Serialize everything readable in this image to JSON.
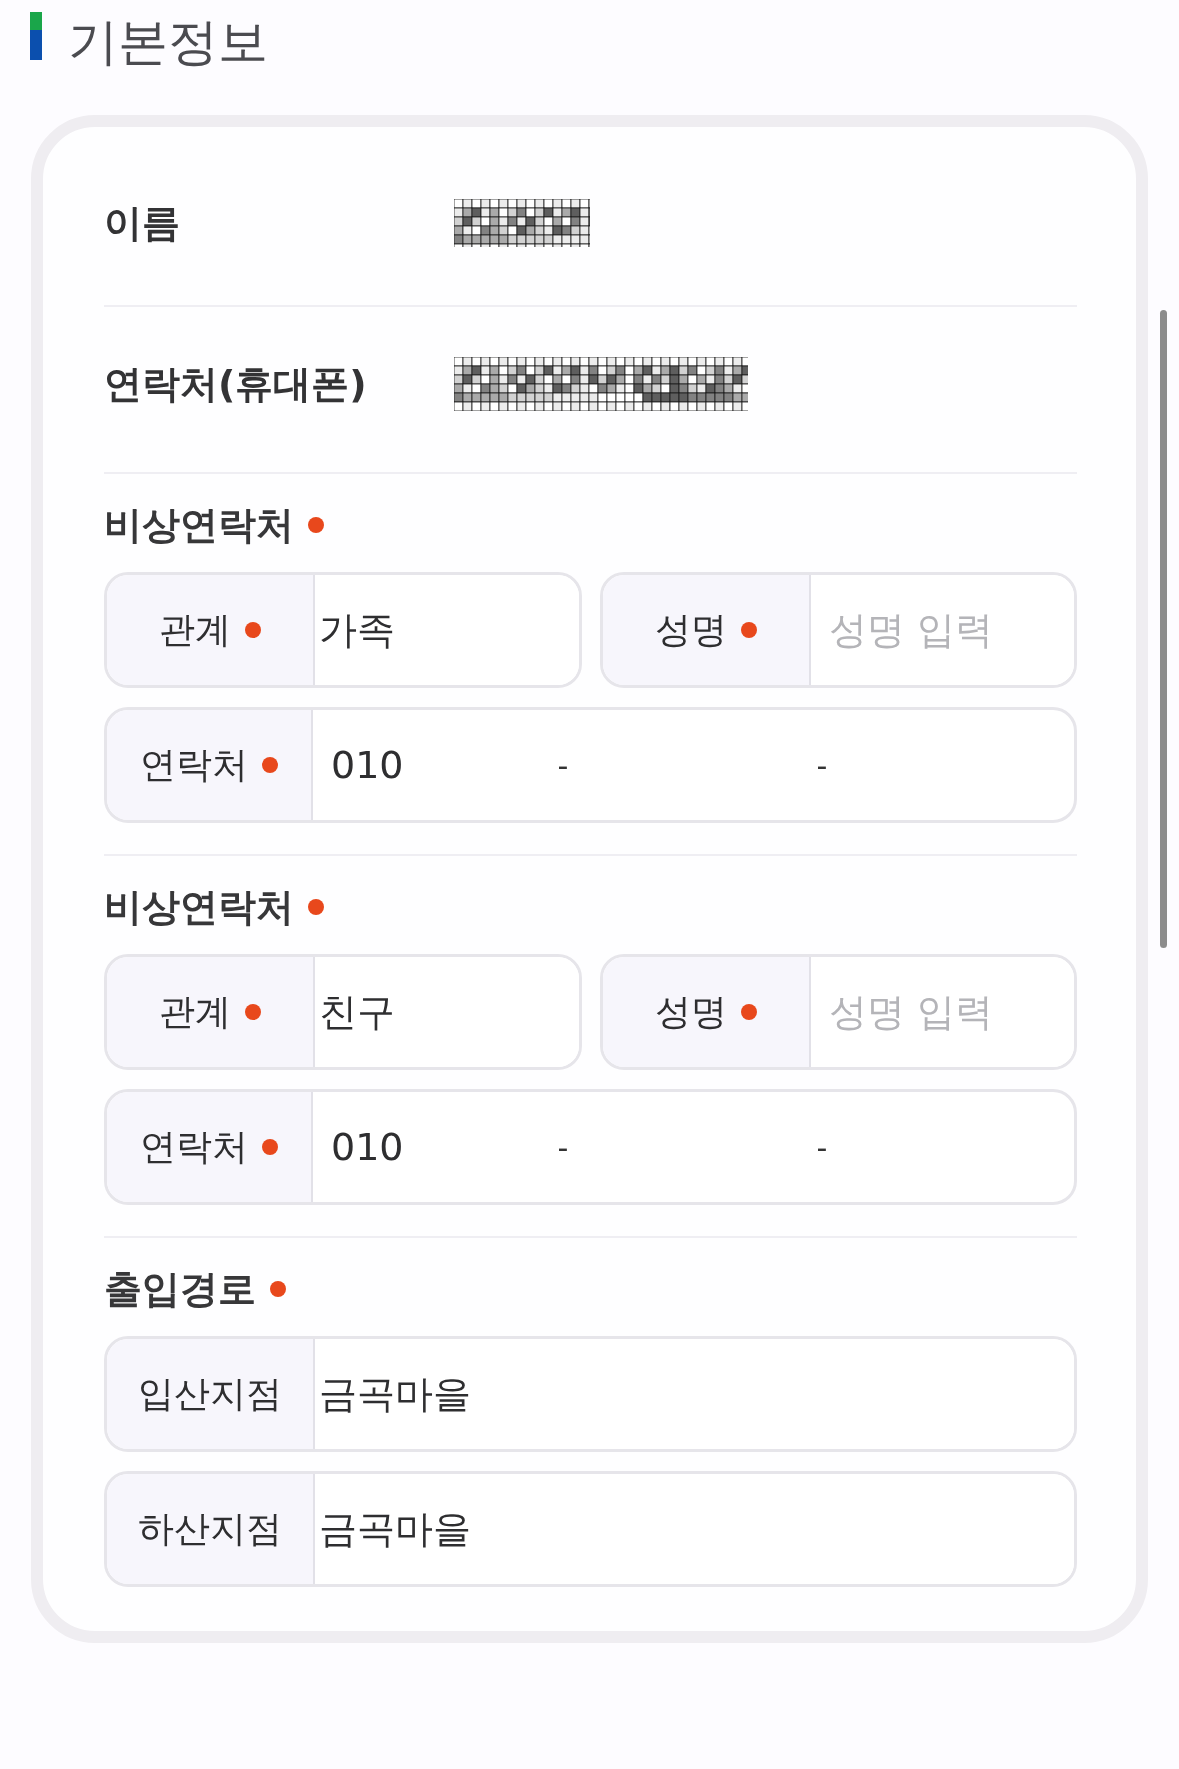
{
  "section": {
    "title": "기본정보"
  },
  "profile_rows": [
    {
      "kind": "name",
      "label": "이름"
    },
    {
      "kind": "phone",
      "label": "연락처(휴대폰)"
    }
  ],
  "emergency_contacts": [
    {
      "title": "비상연락처",
      "required": true,
      "relation": {
        "label": "관계",
        "required": true,
        "kind": "select",
        "value": "가족"
      },
      "name": {
        "label": "성명",
        "required": true,
        "kind": "input",
        "placeholder": "성명 입력"
      },
      "phone": {
        "label": "연락처",
        "required": true,
        "prefix": "010",
        "separators": [
          "-",
          "-"
        ]
      }
    },
    {
      "title": "비상연락처",
      "required": true,
      "relation": {
        "label": "관계",
        "required": true,
        "kind": "select",
        "value": "친구"
      },
      "name": {
        "label": "성명",
        "required": true,
        "kind": "input",
        "placeholder": "성명 입력"
      },
      "phone": {
        "label": "연락처",
        "required": true,
        "prefix": "010",
        "separators": [
          "-",
          "-"
        ]
      }
    }
  ],
  "entry_route": {
    "title": "출입경로",
    "required": true,
    "fields": [
      {
        "label": "입산지점",
        "required": false,
        "kind": "select",
        "value": "금곡마을"
      },
      {
        "label": "하산지점",
        "required": false,
        "kind": "select",
        "value": "금곡마을"
      }
    ]
  }
}
